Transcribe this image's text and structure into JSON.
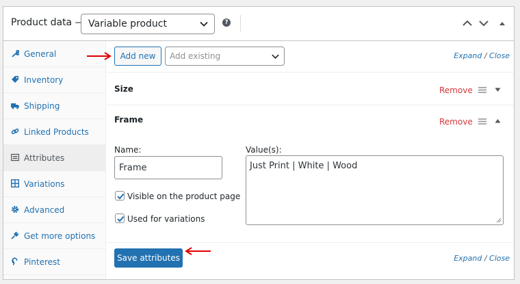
{
  "header": {
    "title": "Product data —",
    "product_type": "Variable product",
    "help_icon_glyph": "?"
  },
  "sidebar": {
    "items": [
      {
        "label": "General",
        "icon": "wrench-icon"
      },
      {
        "label": "Inventory",
        "icon": "tag-icon"
      },
      {
        "label": "Shipping",
        "icon": "truck-icon"
      },
      {
        "label": "Linked Products",
        "icon": "link-icon"
      },
      {
        "label": "Attributes",
        "icon": "list-icon",
        "active": true
      },
      {
        "label": "Variations",
        "icon": "grid-icon"
      },
      {
        "label": "Advanced",
        "icon": "gear-icon"
      },
      {
        "label": "Get more options",
        "icon": "plug-icon"
      },
      {
        "label": "Pinterest",
        "icon": "pinterest-icon"
      }
    ]
  },
  "toolbar": {
    "add_new_label": "Add new",
    "add_existing_placeholder": "Add existing",
    "expand_label": "Expand",
    "separator": " / ",
    "close_label": "Close"
  },
  "attributes": [
    {
      "name": "Size",
      "remove_label": "Remove",
      "expanded": false
    },
    {
      "name": "Frame",
      "remove_label": "Remove",
      "expanded": true
    }
  ],
  "attribute_form": {
    "name_label": "Name:",
    "name_value": "Frame",
    "values_label": "Value(s):",
    "values_value": "Just Print | White | Wood",
    "visible_label": "Visible on the product page",
    "visible_checked": true,
    "variations_label": "Used for variations",
    "variations_checked": true
  },
  "footer": {
    "save_label": "Save attributes",
    "expand_label": "Expand",
    "separator": " / ",
    "close_label": "Close"
  },
  "colors": {
    "link": "#2271b1",
    "remove": "#d63638",
    "annotation_arrow": "#e00000",
    "primary_button": "#2271b1"
  }
}
